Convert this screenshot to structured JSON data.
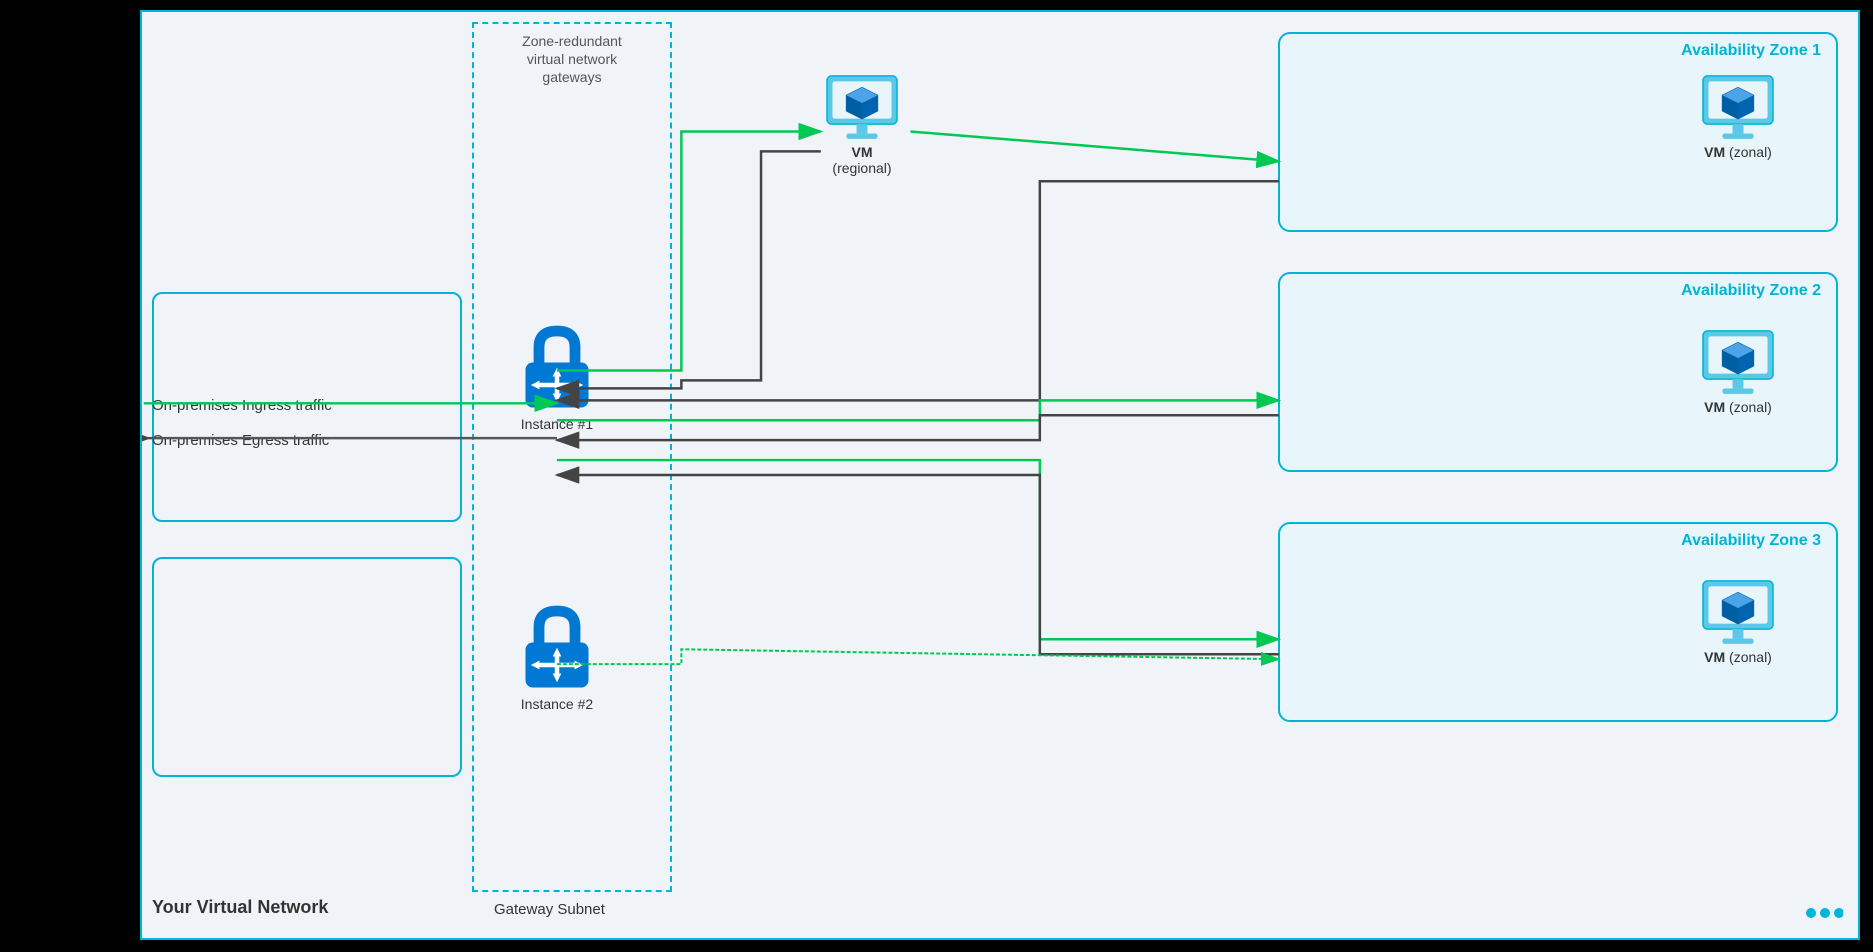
{
  "diagram": {
    "title": "Zone-redundant virtual network gateways",
    "vnet_label": "Your Virtual Network",
    "gateway_subnet_label": "Gateway Subnet",
    "on_prem_ingress": "On-premises Ingress traffic",
    "on_prem_egress": "On-premises Egress traffic",
    "az1_label": "Availability Zone 1",
    "az2_label": "Availability Zone 2",
    "az3_label": "Availability Zone 3",
    "instance1_label": "Instance #1",
    "instance2_label": "Instance #2",
    "vm_regional_label": "VM",
    "vm_regional_sub": "(regional)",
    "vm_zonal_label": "VM",
    "vm_zonal_sub": "(zonal)",
    "colors": {
      "cyan": "#00b4d8",
      "dark_blue": "#0078d4",
      "green_arrow": "#00c853",
      "black_arrow": "#333333",
      "bg": "#f0f4f8",
      "az_bg": "#e8f6fb"
    }
  }
}
